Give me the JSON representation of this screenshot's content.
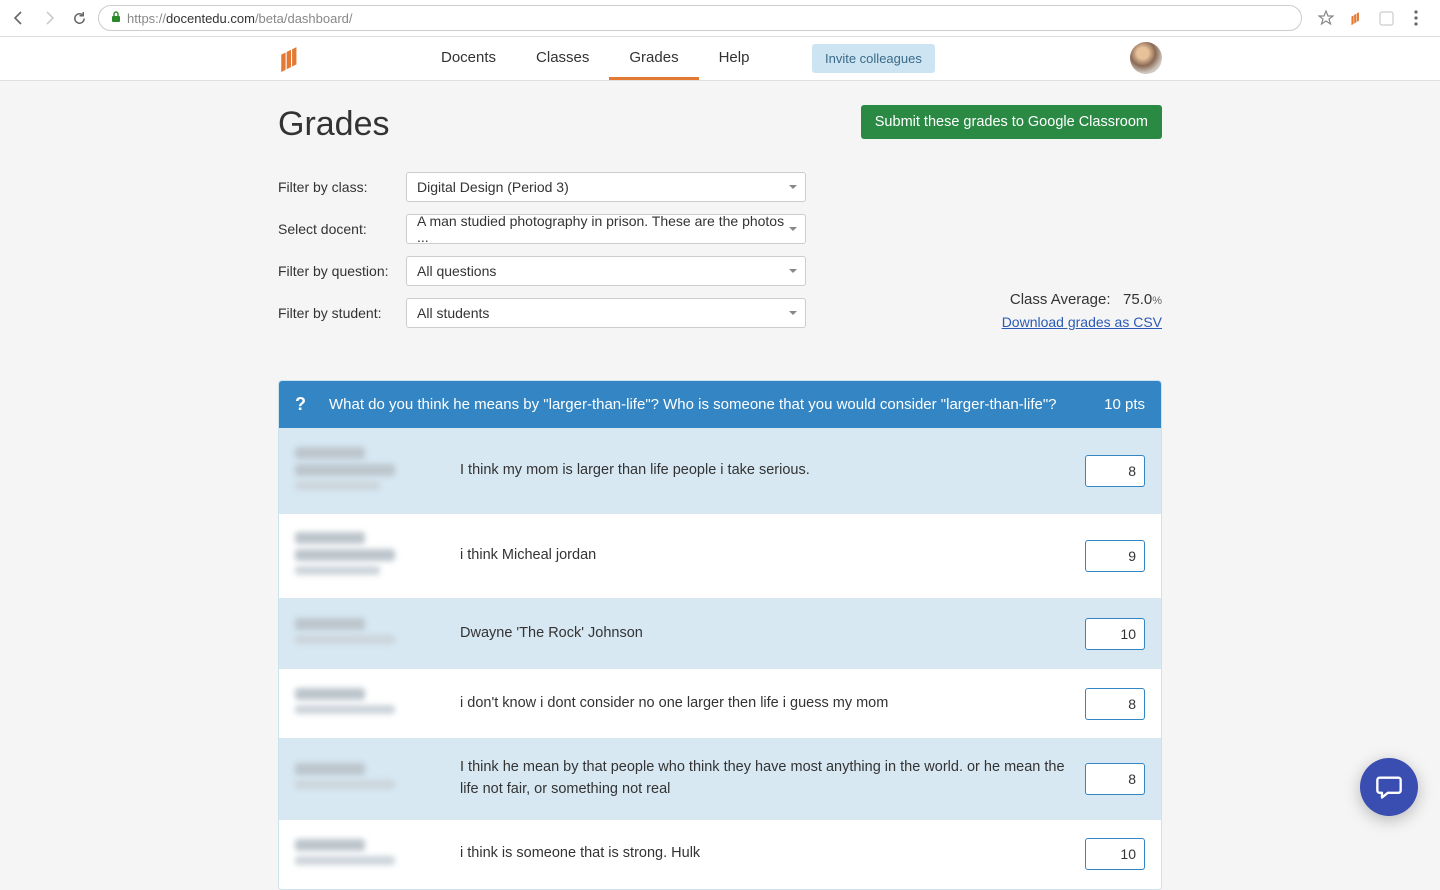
{
  "browser": {
    "url_scheme": "https://",
    "url_host": "docentedu.com",
    "url_path": "/beta/dashboard/"
  },
  "nav": {
    "tabs": [
      "Docents",
      "Classes",
      "Grades",
      "Help"
    ],
    "active_index": 2,
    "invite_label": "Invite colleagues"
  },
  "page": {
    "title": "Grades",
    "submit_label": "Submit these grades to Google Classroom"
  },
  "filters": {
    "class_label": "Filter by class:",
    "class_value": "Digital Design (Period 3)",
    "docent_label": "Select docent:",
    "docent_value": "A man studied photography in prison. These are the photos ...",
    "question_label": "Filter by question:",
    "question_value": "All questions",
    "student_label": "Filter by student:",
    "student_value": "All students"
  },
  "stats": {
    "avg_label": "Class Average:",
    "avg_value": "75.0",
    "avg_unit": "%",
    "csv_label": "Download grades as CSV"
  },
  "question": {
    "text": "What do you think he means by \"larger-than-life\"? Who is someone that you would consider \"larger-than-life\"?",
    "points": "10 pts"
  },
  "answers": [
    {
      "text": "I think my mom is larger than  life people i take serious.",
      "grade": "8",
      "shade": true,
      "lines": 3
    },
    {
      "text": "i think Micheal jordan",
      "grade": "9",
      "shade": false,
      "lines": 3
    },
    {
      "text": "Dwayne 'The Rock' Johnson",
      "grade": "10",
      "shade": true,
      "lines": 2
    },
    {
      "text": "i don't know    i dont consider no one larger then life   i guess my mom",
      "grade": "8",
      "shade": false,
      "lines": 2
    },
    {
      "text": "I think he mean by  that people who think they have most anything in the world. or he mean the life not fair, or something not real",
      "grade": "8",
      "shade": true,
      "lines": 2
    },
    {
      "text": "i think is someone that is strong. Hulk",
      "grade": "10",
      "shade": false,
      "lines": 2
    }
  ]
}
